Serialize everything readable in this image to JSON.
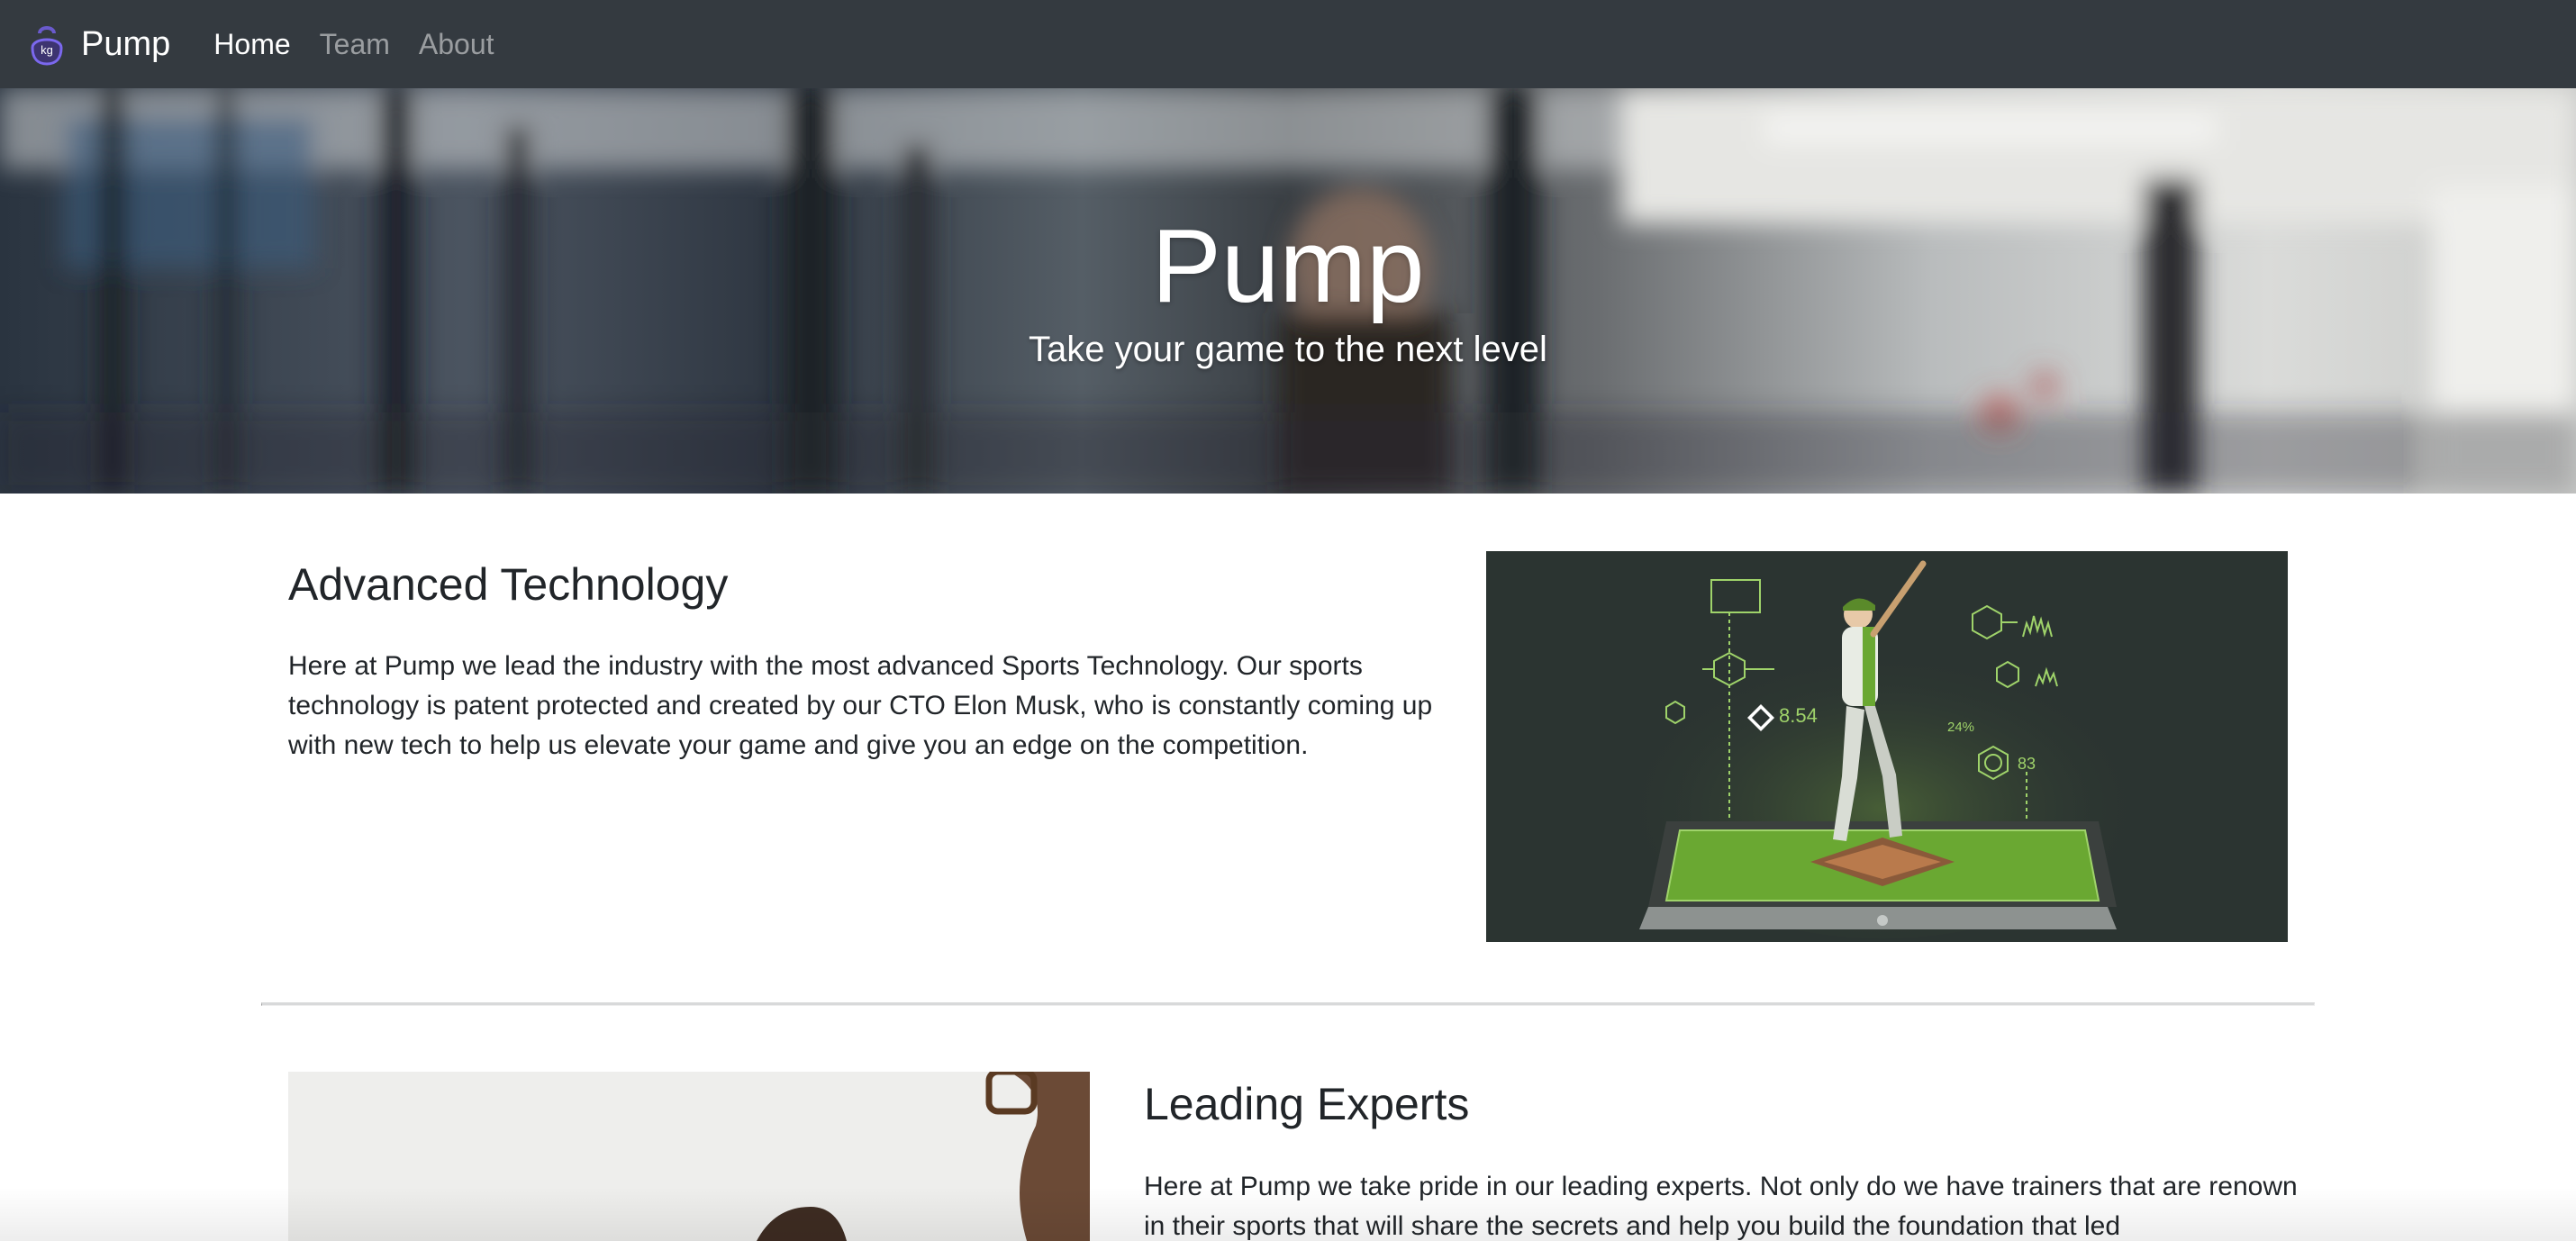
{
  "navbar": {
    "brand_name": "Pump",
    "logo_icon": "kettlebell-logo-icon",
    "logo_text": "kg",
    "links": [
      {
        "label": "Home",
        "active": true
      },
      {
        "label": "Team",
        "active": false
      },
      {
        "label": "About",
        "active": false
      }
    ],
    "background_color": "#343a40"
  },
  "hero": {
    "title": "Pump",
    "subtitle": "Take your game to the next level"
  },
  "features": [
    {
      "heading": "Advanced Technology",
      "text": "Here at Pump we lead the industry with the most advanced Sports Technology. Our sports technology is patent protected and created by our CTO Elon Musk, who is constantly coming up with new tech to help us elevate your game and give you an edge on the competition.",
      "image_icon": "baseball-player-tech-illustration",
      "image_labels": [
        "8.54",
        "24%",
        "83"
      ]
    },
    {
      "heading": "Leading Experts",
      "text": "Here at Pump we take pride in our leading experts. Not only do we have trainers that are renown in their sports that will share the secrets and help you build the foundation that led",
      "image_icon": "expert-photo"
    }
  ],
  "colors": {
    "accent_green": "#7cb342",
    "divider": "#d8d9da"
  }
}
